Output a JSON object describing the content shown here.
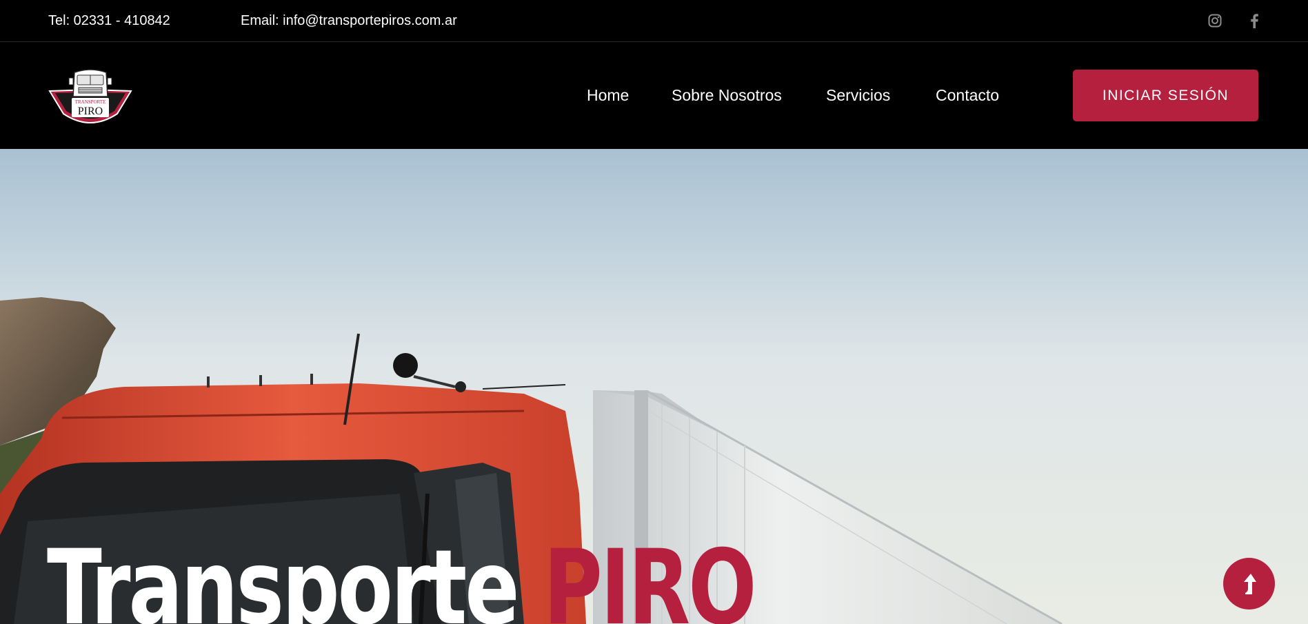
{
  "topbar": {
    "tel": "Tel: 02331 - 410842",
    "email": "Email: info@transportepiros.com.ar",
    "social": [
      {
        "icon": "instagram-icon"
      },
      {
        "icon": "facebook-icon"
      }
    ]
  },
  "logo": {
    "line1": "TRANSPORTE",
    "line2": "PIRO"
  },
  "nav": {
    "items": [
      {
        "label": "Home"
      },
      {
        "label": "Sobre Nosotros"
      },
      {
        "label": "Servicios"
      },
      {
        "label": "Contacto"
      }
    ],
    "login_label": "INICIAR SESIÓN"
  },
  "hero": {
    "title_part1": "Transporte",
    "title_part2": "PIRO"
  },
  "scroll_top": {
    "icon": "arrow-up-icon"
  },
  "colors": {
    "accent": "#b5203f",
    "header_bg": "#000000",
    "text_light": "#ffffff",
    "social_icon": "#8c8c8c"
  }
}
